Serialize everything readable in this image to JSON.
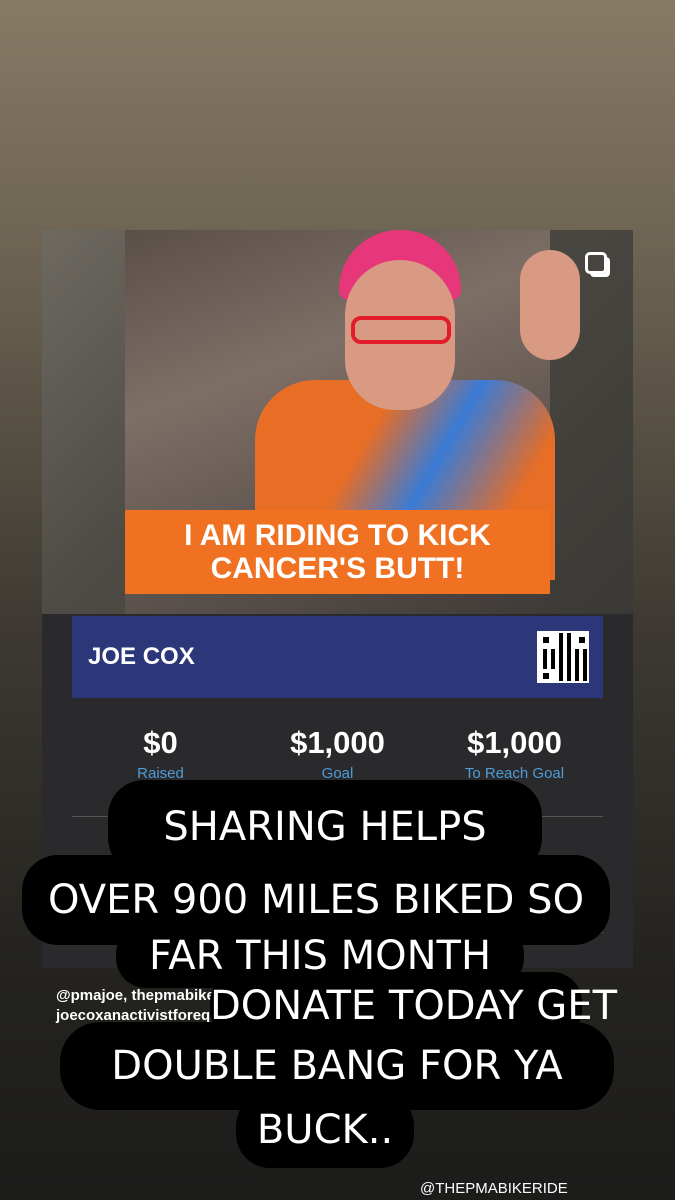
{
  "card": {
    "banner_line1": "I AM RIDING TO KICK",
    "banner_line2": "CANCER'S BUTT!",
    "name": "JOE COX",
    "stats": [
      {
        "amount": "$0",
        "label": "Raised"
      },
      {
        "amount": "$1,000",
        "label": "Goal"
      },
      {
        "amount": "$1,000",
        "label": "To Reach Goal"
      }
    ]
  },
  "tag_credit": "@pmajoe, thepmabikeride and joecoxanactivistforequity",
  "captions": [
    "SHARING HELPS",
    "OVER 900 MILES BIKED SO",
    "FAR THIS MONTH",
    "DONATE TODAY GET",
    "DOUBLE BANG FOR YA",
    "BUCK.."
  ],
  "watermark": "@THEPMABIKERIDE",
  "colors": {
    "banner": "#f07122",
    "name_band": "#2b3778",
    "label_blue": "#4e9bd8",
    "caption_bg": "#000000"
  },
  "icons": {
    "multi_photo": "multiple-photos-icon",
    "qr": "qr-code-icon"
  }
}
